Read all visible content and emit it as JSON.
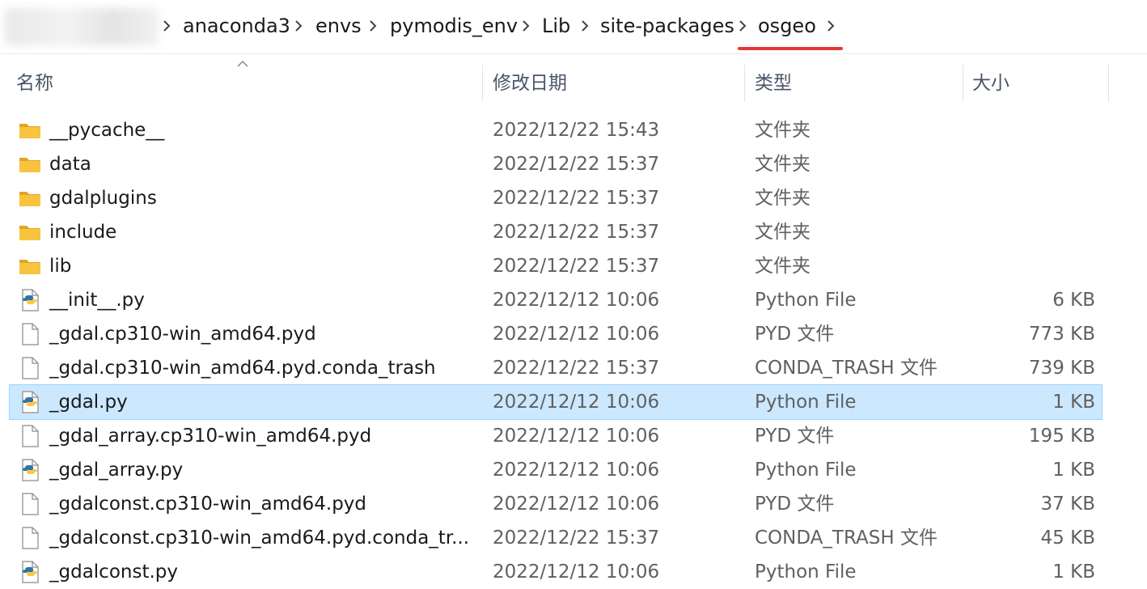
{
  "breadcrumb": {
    "segments": [
      "anaconda3",
      "envs",
      "pymodis_env",
      "Lib",
      "site-packages",
      "osgeo"
    ],
    "highlight_color": "#e53935"
  },
  "columns": {
    "name": "名称",
    "date": "修改日期",
    "type": "类型",
    "size": "大小"
  },
  "files": [
    {
      "name": "__pycache__",
      "date": "2022/12/22 15:43",
      "type": "文件夹",
      "size": "",
      "icon": "folder-icon"
    },
    {
      "name": "data",
      "date": "2022/12/22 15:37",
      "type": "文件夹",
      "size": "",
      "icon": "folder-icon"
    },
    {
      "name": "gdalplugins",
      "date": "2022/12/22 15:37",
      "type": "文件夹",
      "size": "",
      "icon": "folder-icon"
    },
    {
      "name": "include",
      "date": "2022/12/22 15:37",
      "type": "文件夹",
      "size": "",
      "icon": "folder-icon"
    },
    {
      "name": "lib",
      "date": "2022/12/22 15:37",
      "type": "文件夹",
      "size": "",
      "icon": "folder-icon"
    },
    {
      "name": "__init__.py",
      "date": "2022/12/12 10:06",
      "type": "Python File",
      "size": "6 KB",
      "icon": "python-file-icon"
    },
    {
      "name": "_gdal.cp310-win_amd64.pyd",
      "date": "2022/12/12 10:06",
      "type": "PYD 文件",
      "size": "773 KB",
      "icon": "file-icon"
    },
    {
      "name": "_gdal.cp310-win_amd64.pyd.conda_trash",
      "date": "2022/12/22 15:37",
      "type": "CONDA_TRASH 文件",
      "size": "739 KB",
      "icon": "file-icon"
    },
    {
      "name": "_gdal.py",
      "date": "2022/12/12 10:06",
      "type": "Python File",
      "size": "1 KB",
      "icon": "python-file-icon",
      "selected": true
    },
    {
      "name": "_gdal_array.cp310-win_amd64.pyd",
      "date": "2022/12/12 10:06",
      "type": "PYD 文件",
      "size": "195 KB",
      "icon": "file-icon"
    },
    {
      "name": "_gdal_array.py",
      "date": "2022/12/12 10:06",
      "type": "Python File",
      "size": "1 KB",
      "icon": "python-file-icon"
    },
    {
      "name": "_gdalconst.cp310-win_amd64.pyd",
      "date": "2022/12/12 10:06",
      "type": "PYD 文件",
      "size": "37 KB",
      "icon": "file-icon"
    },
    {
      "name": "_gdalconst.cp310-win_amd64.pyd.conda_tr...",
      "date": "2022/12/22 15:37",
      "type": "CONDA_TRASH 文件",
      "size": "45 KB",
      "icon": "file-icon"
    },
    {
      "name": "_gdalconst.py",
      "date": "2022/12/12 10:06",
      "type": "Python File",
      "size": "1 KB",
      "icon": "python-file-icon"
    }
  ],
  "colors": {
    "selection_bg": "#cce8ff",
    "selection_border": "#99d1ff",
    "folder": "#f8c33f"
  }
}
